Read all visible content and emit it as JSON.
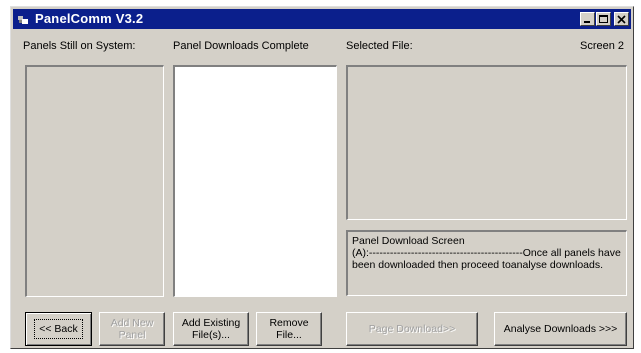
{
  "window": {
    "title": "PanelComm V3.2",
    "screen_label": "Screen 2"
  },
  "labels": {
    "panels_on_system": "Panels Still on System:",
    "downloads_complete": "Panel Downloads Complete",
    "selected_file": "Selected File:"
  },
  "status": {
    "line1": "Panel Download Screen",
    "line2": "(A):--------------------------------------------Once all panels have",
    "line3": "been downloaded then proceed toanalyse downloads."
  },
  "buttons": {
    "back": "<< Back",
    "add_new_panel": "Add New\nPanel",
    "add_existing": "Add Existing\nFile(s)...",
    "remove_file": "Remove\nFile...",
    "page_download": "Page Download>>",
    "analyse_downloads": "Analyse Downloads >>>"
  },
  "states": {
    "add_new_panel_enabled": false,
    "page_download_enabled": false,
    "back_focused": true
  }
}
